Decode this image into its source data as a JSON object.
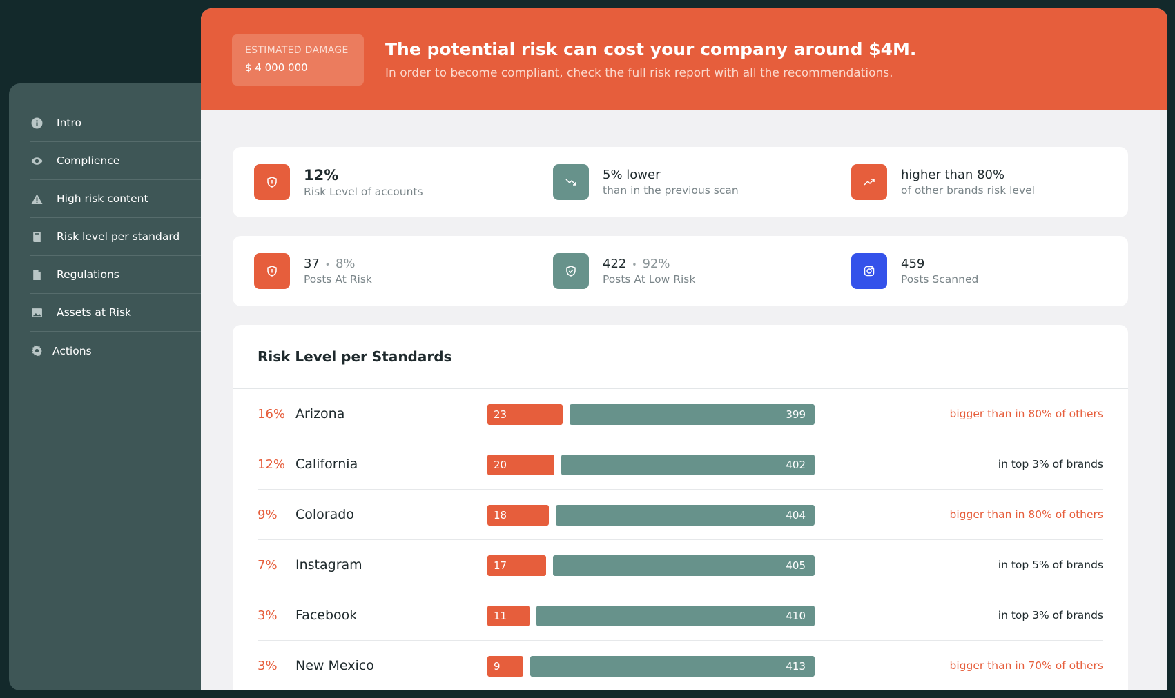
{
  "sidebar": {
    "items": [
      {
        "label": "Intro",
        "icon": "info-icon"
      },
      {
        "label": "Complience",
        "icon": "eye-icon"
      },
      {
        "label": "High risk content",
        "icon": "warning-icon"
      },
      {
        "label": "Risk level per standard",
        "icon": "book-icon"
      },
      {
        "label": "Regulations",
        "icon": "document-icon"
      },
      {
        "label": "Assets at Risk",
        "icon": "image-icon"
      },
      {
        "label": "Actions",
        "icon": "gear-icon"
      }
    ]
  },
  "banner": {
    "damage_title": "ESTIMATED DAMAGE",
    "damage_value": "$ 4 000 000",
    "title": "The potential risk can cost your company around $4M.",
    "subtitle": "In order to become compliant, check the full risk report with all the recommendations."
  },
  "stats_top": [
    {
      "main": "12%",
      "sub": "Risk Level of accounts",
      "icon": "shield-alert-icon",
      "color": "#e65e3c"
    },
    {
      "main": "5% lower",
      "sub": "than in the previous scan",
      "icon": "trend-down-icon",
      "color": "#67928b"
    },
    {
      "main": "higher than 80%",
      "sub": "of other brands risk level",
      "icon": "trend-up-icon",
      "color": "#e65e3c"
    }
  ],
  "stats_bottom": [
    {
      "count": "37",
      "pct": "8%",
      "sub": "Posts At Risk",
      "icon": "shield-alert-icon",
      "color": "#e65e3c"
    },
    {
      "count": "422",
      "pct": "92%",
      "sub": "Posts At Low Risk",
      "icon": "shield-check-icon",
      "color": "#67928b"
    },
    {
      "count": "459",
      "sub": "Posts Scanned",
      "icon": "instagram-icon",
      "color": "#3452ea"
    }
  ],
  "risk": {
    "title": "Risk Level per Standards",
    "rows": [
      {
        "pct": "16%",
        "name": "Arizona",
        "at_risk": "23",
        "low_risk": "399",
        "note": "bigger than in 80% of others",
        "note_color": "red"
      },
      {
        "pct": "12%",
        "name": "California",
        "at_risk": "20",
        "low_risk": "402",
        "note": "in top 3% of brands",
        "note_color": "dark"
      },
      {
        "pct": "9%",
        "name": "Colorado",
        "at_risk": "18",
        "low_risk": "404",
        "note": "bigger than in 80% of others",
        "note_color": "red"
      },
      {
        "pct": "7%",
        "name": "Instagram",
        "at_risk": "17",
        "low_risk": "405",
        "note": "in top 5% of brands",
        "note_color": "dark"
      },
      {
        "pct": "3%",
        "name": "Facebook",
        "at_risk": "11",
        "low_risk": "410",
        "note": "in top 3% of brands",
        "note_color": "dark"
      },
      {
        "pct": "3%",
        "name": "New Mexico",
        "at_risk": "9",
        "low_risk": "413",
        "note": "bigger than in 70% of others",
        "note_color": "red"
      }
    ]
  }
}
